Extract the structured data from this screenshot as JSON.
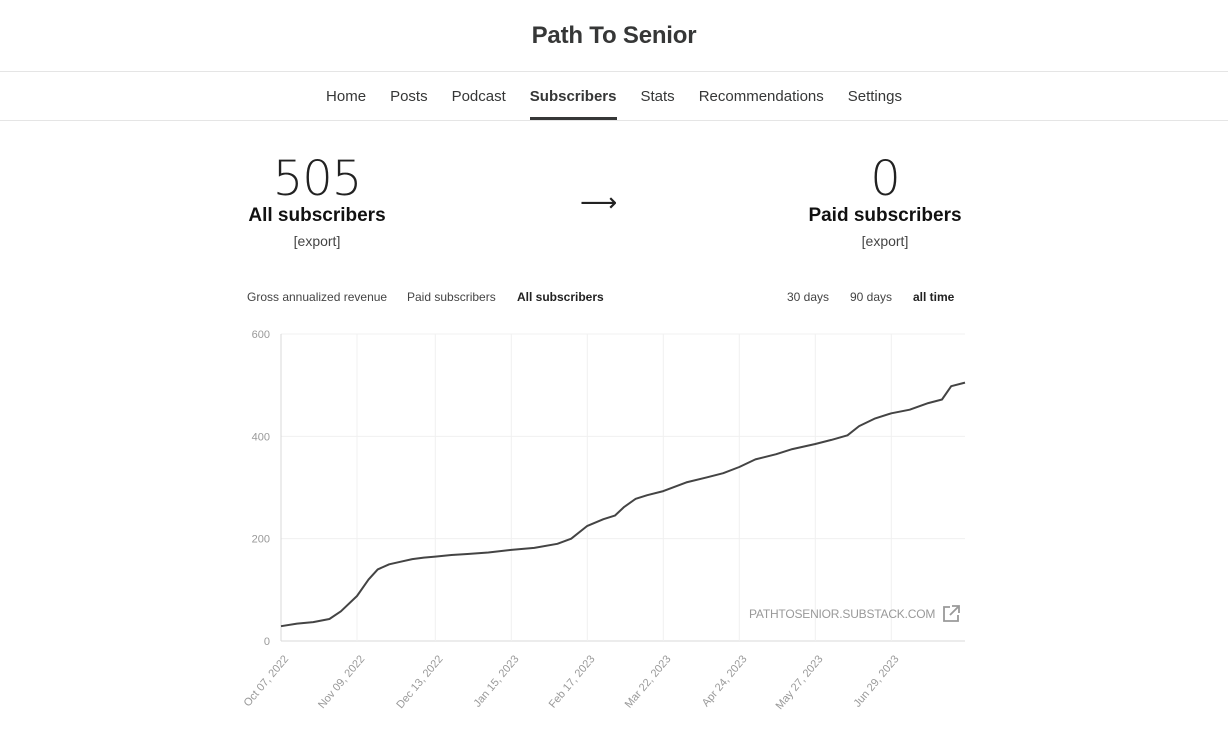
{
  "header": {
    "title": "Path To Senior"
  },
  "nav": {
    "tabs": [
      {
        "label": "Home",
        "active": false
      },
      {
        "label": "Posts",
        "active": false
      },
      {
        "label": "Podcast",
        "active": false
      },
      {
        "label": "Subscribers",
        "active": true
      },
      {
        "label": "Stats",
        "active": false
      },
      {
        "label": "Recommendations",
        "active": false
      },
      {
        "label": "Settings",
        "active": false
      }
    ]
  },
  "summary": {
    "all": {
      "value": "505",
      "label": "All subscribers",
      "export": "[export]"
    },
    "arrow": "⟶",
    "paid": {
      "value": "0",
      "label": "Paid subscribers",
      "export": "[export]"
    }
  },
  "metric_tabs": {
    "gross": "Gross annualized revenue",
    "paid": "Paid subscribers",
    "all": "All subscribers",
    "active": "all"
  },
  "range_tabs": {
    "d30": "30 days",
    "d90": "90 days",
    "all": "all time",
    "active": "all"
  },
  "watermark": {
    "text": "PATHTOSENIOR.SUBSTACK.COM",
    "icon": "external-link-icon"
  },
  "chart_data": {
    "type": "line",
    "title": "",
    "xlabel": "",
    "ylabel": "",
    "ylim": [
      0,
      600
    ],
    "yticks": [
      0,
      200,
      400,
      600
    ],
    "xlim": [
      "2022-10-07",
      "2023-07-31"
    ],
    "xticks": [
      "Oct 07, 2022",
      "Nov 09, 2022",
      "Dec 13, 2022",
      "Jan 15, 2023",
      "Feb 17, 2023",
      "Mar 22, 2023",
      "Apr 24, 2023",
      "May 27, 2023",
      "Jun 29, 2023"
    ],
    "grid": true,
    "line_color": "#444444",
    "series": [
      {
        "x": [
          "2022-10-07",
          "2022-10-14",
          "2022-10-21",
          "2022-10-28",
          "2022-11-02",
          "2022-11-09",
          "2022-11-14",
          "2022-11-18",
          "2022-11-23",
          "2022-11-28",
          "2022-12-03",
          "2022-12-08",
          "2022-12-13",
          "2022-12-20",
          "2022-12-27",
          "2023-01-05",
          "2023-01-15",
          "2023-01-25",
          "2023-02-04",
          "2023-02-10",
          "2023-02-17",
          "2023-02-24",
          "2023-03-01",
          "2023-03-05",
          "2023-03-10",
          "2023-03-15",
          "2023-03-22",
          "2023-04-01",
          "2023-04-10",
          "2023-04-17",
          "2023-04-24",
          "2023-05-01",
          "2023-05-10",
          "2023-05-17",
          "2023-05-27",
          "2023-06-03",
          "2023-06-10",
          "2023-06-15",
          "2023-06-22",
          "2023-06-29",
          "2023-07-07",
          "2023-07-15",
          "2023-07-21",
          "2023-07-25",
          "2023-07-31"
        ],
        "values": [
          29,
          34,
          37,
          43,
          58,
          88,
          120,
          140,
          150,
          155,
          160,
          163,
          165,
          168,
          170,
          173,
          178,
          182,
          190,
          200,
          225,
          238,
          245,
          262,
          278,
          285,
          293,
          310,
          320,
          328,
          340,
          355,
          365,
          375,
          385,
          393,
          402,
          420,
          435,
          445,
          452,
          465,
          472,
          498,
          505
        ]
      }
    ]
  }
}
